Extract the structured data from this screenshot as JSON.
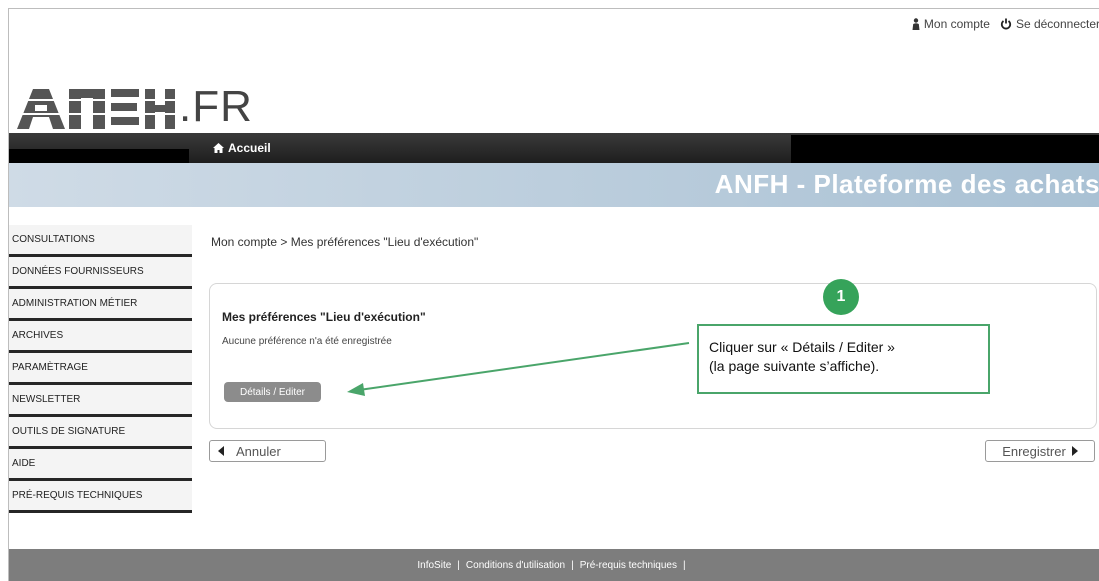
{
  "topbar": {
    "account_label": "Mon compte",
    "logout_label": "Se déconnecter"
  },
  "logo": {
    "suffix": ".FR"
  },
  "nav": {
    "home_label": "Accueil"
  },
  "banner": {
    "title": "ANFH - Plateforme des achats"
  },
  "sidebar": {
    "items": [
      {
        "label": "CONSULTATIONS"
      },
      {
        "label": "DONNÉES FOURNISSEURS"
      },
      {
        "label": "ADMINISTRATION MÉTIER"
      },
      {
        "label": "ARCHIVES"
      },
      {
        "label": "PARAMÈTRAGE"
      },
      {
        "label": "NEWSLETTER"
      },
      {
        "label": "OUTILS DE SIGNATURE"
      },
      {
        "label": "AIDE"
      },
      {
        "label": "PRÉ-REQUIS TECHNIQUES"
      }
    ]
  },
  "main": {
    "breadcrumb": "Mon compte > Mes préférences \"Lieu d'exécution\"",
    "pref_title": "Mes préférences \"Lieu d'exécution\"",
    "pref_message": "Aucune préférence n'a été enregistrée",
    "details_button": "Détails / Editer",
    "cancel_button": "Annuler",
    "save_button": "Enregistrer"
  },
  "annotation": {
    "badge": "1",
    "line1": "Cliquer sur « Détails / Editer »",
    "line2": "(la page suivante s’affiche).",
    "color": "#36a35a"
  },
  "footer": {
    "links": [
      "InfoSite",
      "Conditions d'utilisation",
      "Pré-requis techniques"
    ]
  }
}
